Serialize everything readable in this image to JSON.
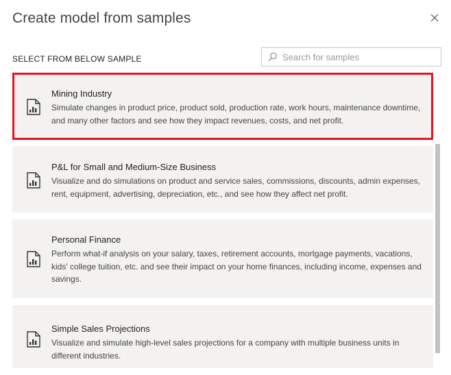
{
  "dialog": {
    "title": "Create model from samples",
    "close_icon": "close-icon"
  },
  "section": {
    "label": "SELECT FROM BELOW SAMPLE"
  },
  "search": {
    "placeholder": "Search for samples",
    "value": "",
    "icon": "search-icon"
  },
  "samples": [
    {
      "title": "Mining Industry",
      "description": "Simulate changes in product price, product sold, production rate, work hours, maintenance downtime, and many other factors and see how they impact revenues, costs, and net profit.",
      "icon": "document-chart-icon",
      "selected": true
    },
    {
      "title": "P&L for Small and Medium-Size Business",
      "description": "Visualize and do simulations on product and service sales, commissions, discounts, admin expenses, rent, equipment, advertising, depreciation, etc., and see how they affect net profit.",
      "icon": "document-chart-icon",
      "selected": false
    },
    {
      "title": "Personal Finance",
      "description": "Perform what-if analysis on your salary, taxes, retirement accounts, mortgage payments, vacations, kids' college tuition, etc. and see their impact on your home finances, including income, expenses and savings.",
      "icon": "document-chart-icon",
      "selected": false
    },
    {
      "title": "Simple Sales Projections",
      "description": "Visualize and simulate high-level sales projections for a company with multiple business units in different industries.",
      "icon": "document-chart-icon",
      "selected": false
    }
  ],
  "colors": {
    "selection_border": "#e8111d",
    "card_background": "#f3f2f1",
    "scrollbar": "#c2c2c2"
  }
}
